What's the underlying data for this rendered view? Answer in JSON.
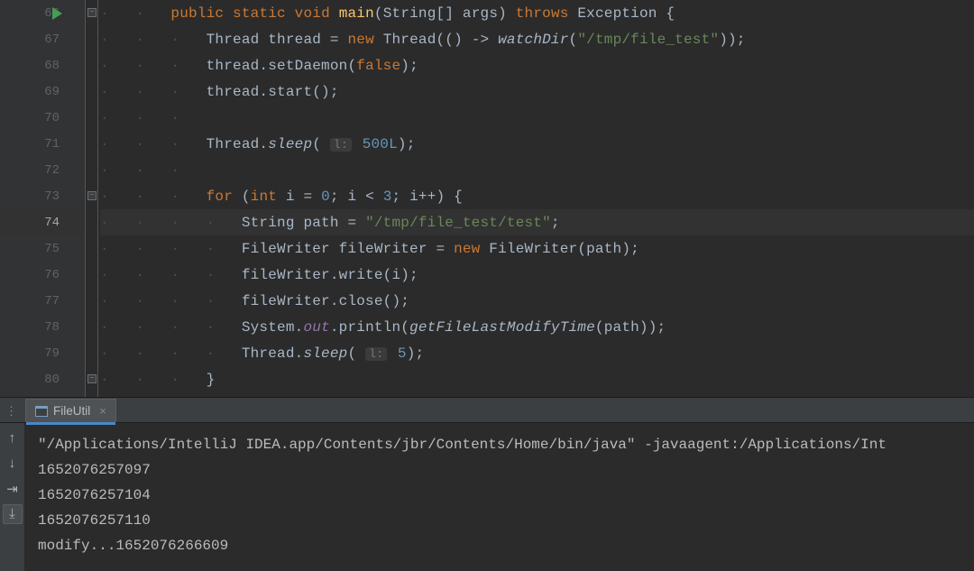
{
  "editor": {
    "first_line_number": 66,
    "highlighted_line": 74,
    "run_marker_line": 66,
    "fold_open_lines": [
      66,
      73
    ],
    "fold_close_lines": [
      80
    ],
    "lines": [
      {
        "indent": 2,
        "tokens": [
          {
            "t": "kw",
            "v": "public "
          },
          {
            "t": "kw",
            "v": "static "
          },
          {
            "t": "kw",
            "v": "void "
          },
          {
            "t": "mname",
            "v": "main"
          },
          {
            "t": "paren",
            "v": "("
          },
          {
            "t": "type",
            "v": "String[] args"
          },
          {
            "t": "paren",
            "v": ") "
          },
          {
            "t": "kw",
            "v": "throws "
          },
          {
            "t": "type",
            "v": "Exception "
          },
          {
            "t": "paren",
            "v": "{"
          }
        ]
      },
      {
        "indent": 3,
        "tokens": [
          {
            "t": "type",
            "v": "Thread thread "
          },
          {
            "t": "punct",
            "v": "= "
          },
          {
            "t": "kw",
            "v": "new "
          },
          {
            "t": "type",
            "v": "Thread"
          },
          {
            "t": "paren",
            "v": "(() -> "
          },
          {
            "t": "ital",
            "v": "watchDir"
          },
          {
            "t": "paren",
            "v": "("
          },
          {
            "t": "str",
            "v": "\"/tmp/file_test\""
          },
          {
            "t": "paren",
            "v": "));"
          }
        ]
      },
      {
        "indent": 3,
        "tokens": [
          {
            "t": "plain",
            "v": "thread.setDaemon("
          },
          {
            "t": "bool",
            "v": "false"
          },
          {
            "t": "plain",
            "v": ");"
          }
        ]
      },
      {
        "indent": 3,
        "tokens": [
          {
            "t": "plain",
            "v": "thread.start();"
          }
        ]
      },
      {
        "indent": 3,
        "tokens": []
      },
      {
        "indent": 3,
        "tokens": [
          {
            "t": "type",
            "v": "Thread."
          },
          {
            "t": "ital",
            "v": "sleep"
          },
          {
            "t": "paren",
            "v": "( "
          },
          {
            "t": "hint",
            "v": "l:"
          },
          {
            "t": "num",
            "v": " 500L"
          },
          {
            "t": "paren",
            "v": ");"
          }
        ]
      },
      {
        "indent": 3,
        "tokens": []
      },
      {
        "indent": 3,
        "tokens": [
          {
            "t": "kw",
            "v": "for "
          },
          {
            "t": "paren",
            "v": "("
          },
          {
            "t": "kw",
            "v": "int "
          },
          {
            "t": "plain",
            "v": "i = "
          },
          {
            "t": "num",
            "v": "0"
          },
          {
            "t": "plain",
            "v": "; i < "
          },
          {
            "t": "num",
            "v": "3"
          },
          {
            "t": "plain",
            "v": "; i++) {"
          }
        ]
      },
      {
        "indent": 4,
        "tokens": [
          {
            "t": "type",
            "v": "String path "
          },
          {
            "t": "punct",
            "v": "= "
          },
          {
            "t": "str",
            "v": "\"/tmp/file_test/test\""
          },
          {
            "t": "plain",
            "v": ";"
          }
        ]
      },
      {
        "indent": 4,
        "tokens": [
          {
            "t": "type",
            "v": "FileWriter fileWriter "
          },
          {
            "t": "punct",
            "v": "= "
          },
          {
            "t": "kw",
            "v": "new "
          },
          {
            "t": "type",
            "v": "FileWriter"
          },
          {
            "t": "paren",
            "v": "(path);"
          }
        ]
      },
      {
        "indent": 4,
        "tokens": [
          {
            "t": "plain",
            "v": "fileWriter.write(i);"
          }
        ]
      },
      {
        "indent": 4,
        "tokens": [
          {
            "t": "plain",
            "v": "fileWriter.close();"
          }
        ]
      },
      {
        "indent": 4,
        "tokens": [
          {
            "t": "type",
            "v": "System."
          },
          {
            "t": "field",
            "v": "out"
          },
          {
            "t": "plain",
            "v": ".println("
          },
          {
            "t": "ital",
            "v": "getFileLastModifyTime"
          },
          {
            "t": "plain",
            "v": "(path));"
          }
        ]
      },
      {
        "indent": 4,
        "tokens": [
          {
            "t": "type",
            "v": "Thread."
          },
          {
            "t": "ital",
            "v": "sleep"
          },
          {
            "t": "paren",
            "v": "( "
          },
          {
            "t": "hint",
            "v": "l:"
          },
          {
            "t": "num",
            "v": " 5"
          },
          {
            "t": "paren",
            "v": ");"
          }
        ]
      },
      {
        "indent": 3,
        "tokens": [
          {
            "t": "plain",
            "v": "}"
          }
        ]
      }
    ]
  },
  "run_panel": {
    "tab_label": "FileUtil",
    "toolbar_icons": [
      "arrow-up-icon",
      "arrow-down-icon",
      "soft-wrap-icon",
      "scroll-to-end-icon"
    ],
    "console_lines": [
      "\"/Applications/IntelliJ IDEA.app/Contents/jbr/Contents/Home/bin/java\" -javaagent:/Applications/Int",
      "1652076257097",
      "1652076257104",
      "1652076257110",
      "modify...1652076266609"
    ]
  }
}
